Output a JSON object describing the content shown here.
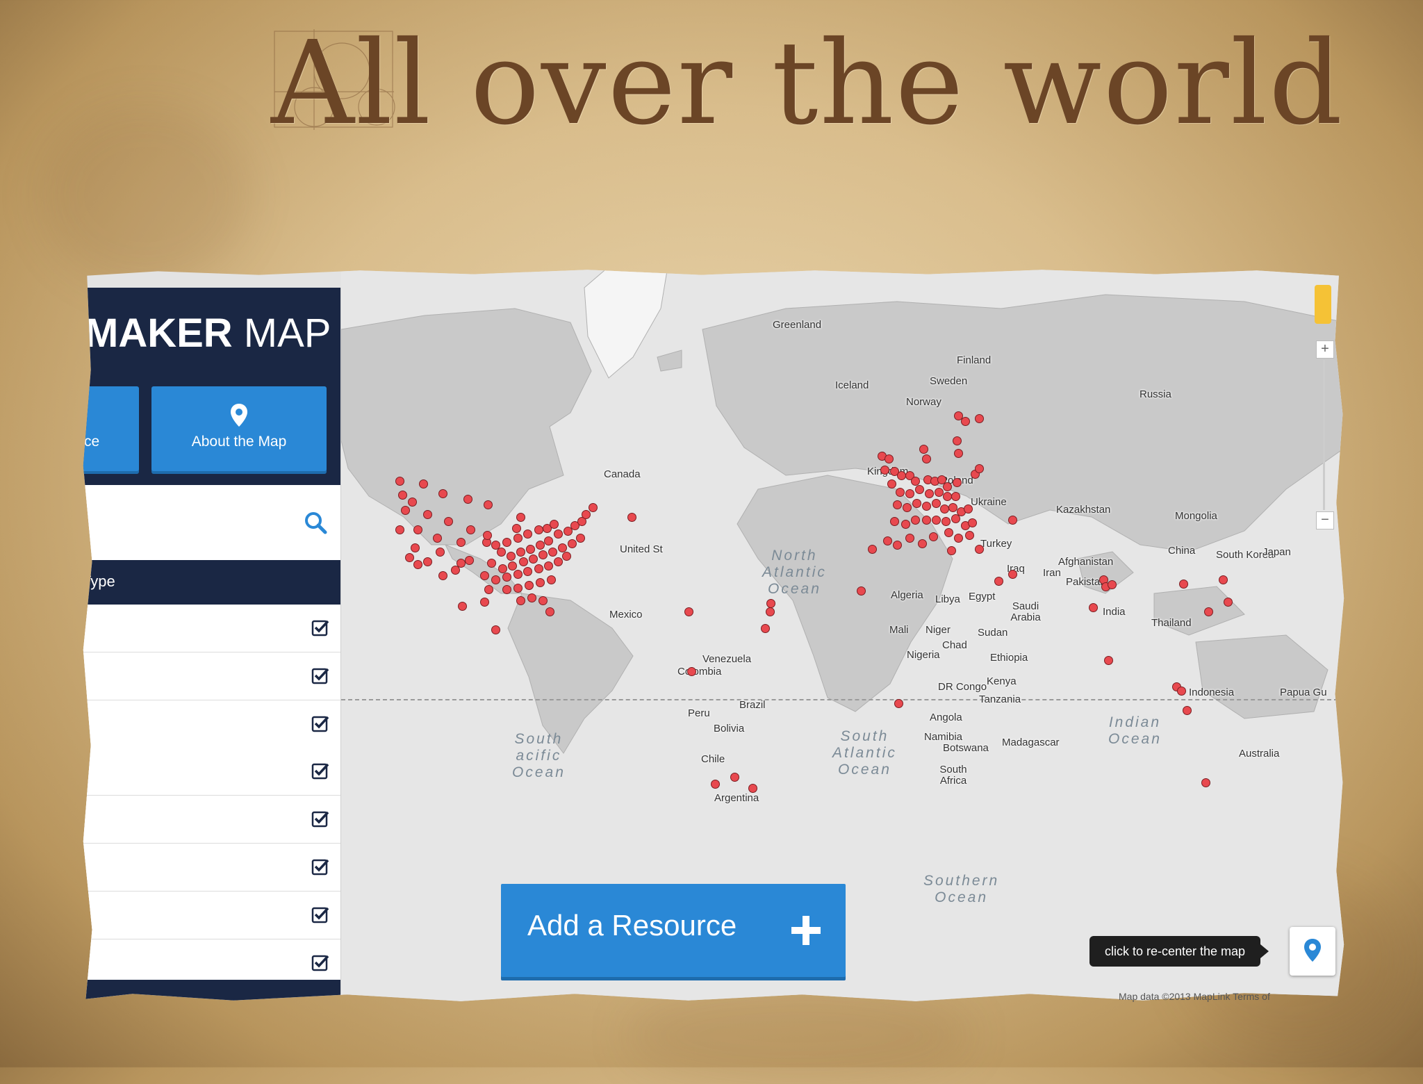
{
  "slide": {
    "title": "All over the world"
  },
  "sidebar": {
    "brand_bold": "MAKER",
    "brand_light": " MAP",
    "nav": [
      {
        "label": "rce",
        "icon": "partial-button"
      },
      {
        "label": "About the Map",
        "icon": "map-pin-icon"
      }
    ],
    "search": {
      "icon": "search-icon"
    },
    "filter_header": "Type",
    "filters": [
      {
        "checked": true
      },
      {
        "checked": true
      },
      {
        "checked": true
      },
      {
        "checked": true
      },
      {
        "checked": true
      },
      {
        "checked": true
      },
      {
        "checked": true
      },
      {
        "checked": true
      }
    ]
  },
  "map": {
    "labels": [
      "Greenland",
      "Iceland",
      "Finland",
      "Sweden",
      "Norway",
      "Russia",
      "Canada",
      "United St",
      "Kingdom",
      "Poland",
      "Ukraine",
      "Kazakhstan",
      "Mongolia",
      "Turkey",
      "Iraq",
      "Iran",
      "Afghanistan",
      "Pakistan",
      "China",
      "South Korea",
      "Japan",
      "Algeria",
      "Libya",
      "Egypt",
      "Saudi Arabia",
      "India",
      "Thailand",
      "Mexico",
      "Mali",
      "Niger",
      "Chad",
      "Sudan",
      "Nigeria",
      "Ethiopia",
      "Venezuela",
      "Colombia",
      "Kenya",
      "DR Congo",
      "Tanzania",
      "Indonesia",
      "Papua Gu",
      "Brazil",
      "Peru",
      "Bolivia",
      "Angola",
      "Namibia",
      "Botswana",
      "Madagascar",
      "Chile",
      "South Africa",
      "Australia",
      "Argentina"
    ],
    "oceans": {
      "north_atlantic": "North\nAtlantic\nOcean",
      "south_atlantic": "South\nAtlantic\nOcean",
      "south_pacific": "South\nacific\nOcean",
      "indian": "Indian\nOcean",
      "southern": "Southern\nOcean"
    },
    "add_button": "Add a Resource",
    "tooltip": "click to re-center the map",
    "attribution": "Map data ©2013 MapLink   Terms of",
    "pin_color": "#e8494f",
    "accent_color": "#2a88d6",
    "header_color": "#1a2744"
  }
}
